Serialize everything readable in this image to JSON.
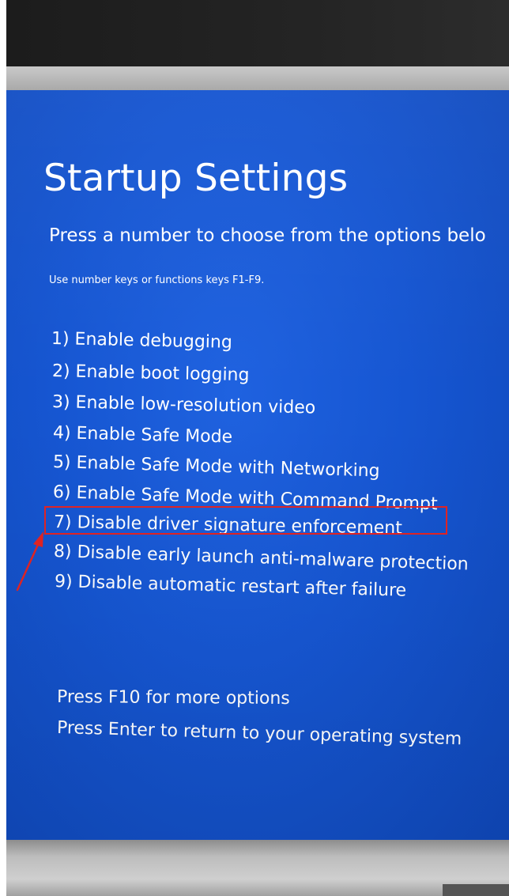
{
  "screen": {
    "title": "Startup Settings",
    "subtitle": "Press a number to choose from the options belo",
    "hint": "Use number keys or functions keys F1-F9.",
    "options": [
      {
        "label": "1) Enable debugging"
      },
      {
        "label": "2) Enable boot logging"
      },
      {
        "label": "3) Enable low-resolution video"
      },
      {
        "label": "4) Enable Safe Mode"
      },
      {
        "label": "5) Enable Safe Mode with Networking"
      },
      {
        "label": "6) Enable Safe Mode with Command Prompt"
      },
      {
        "label": "7) Disable driver signature enforcement"
      },
      {
        "label": "8) Disable early launch anti-malware protection"
      },
      {
        "label": "9) Disable automatic restart after failure"
      }
    ],
    "footer": {
      "more_options": "Press F10 for more options",
      "return": "Press Enter to return to your operating system"
    }
  },
  "annotation": {
    "highlighted_option_index": 7,
    "color": "#e32424"
  },
  "colors": {
    "background": "#1656d2",
    "text": "#ffffff"
  }
}
